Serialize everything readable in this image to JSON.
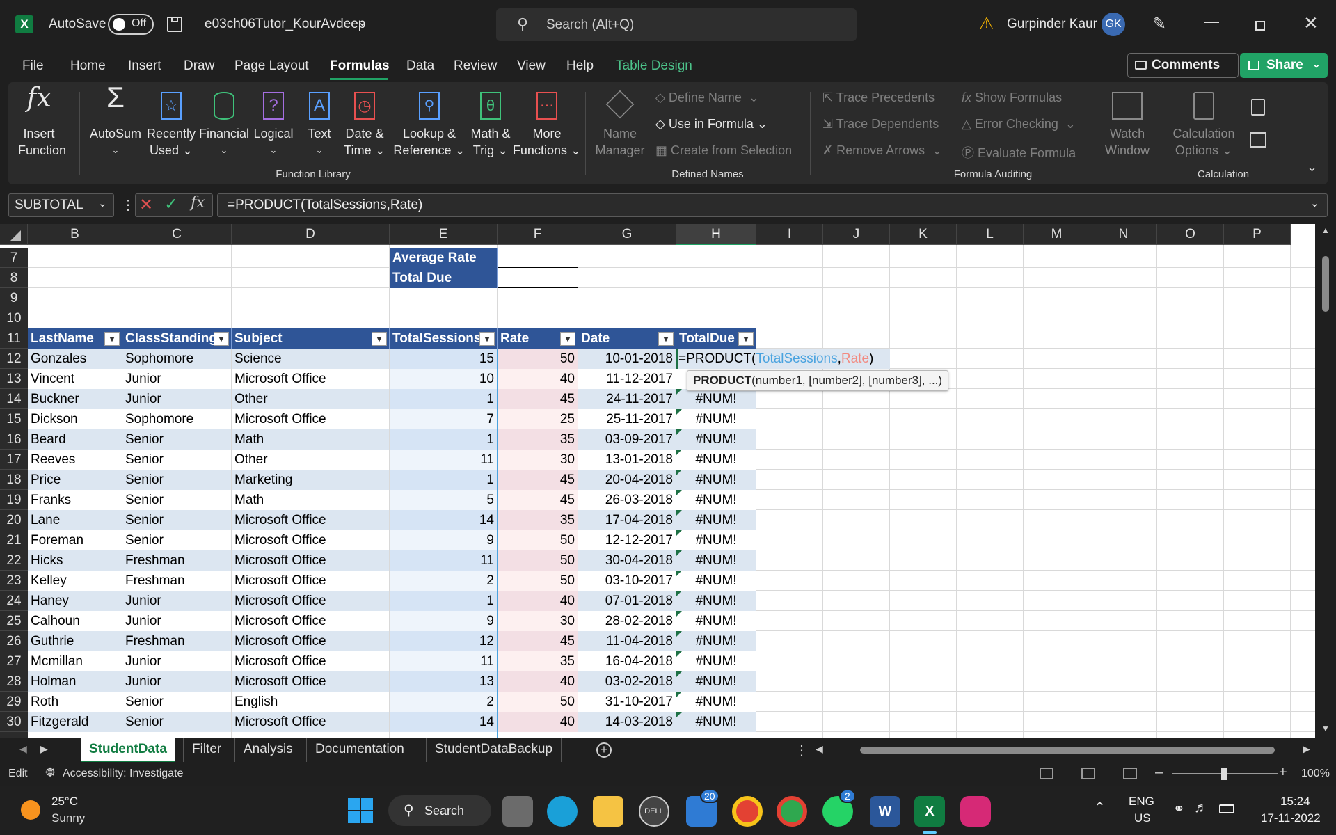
{
  "titlebar": {
    "app_icon": "excel-icon",
    "autosave_label": "AutoSave",
    "autosave_state": "Off",
    "filename": "e03ch06Tutor_KourAvdeep",
    "search_placeholder": "Search (Alt+Q)",
    "user_name": "Gurpinder Kaur",
    "user_initials": "GK"
  },
  "menu": {
    "items": [
      "File",
      "Home",
      "Insert",
      "Draw",
      "Page Layout",
      "Formulas",
      "Data",
      "Review",
      "View",
      "Help",
      "Table Design"
    ],
    "active": "Formulas",
    "comments": "Comments",
    "share": "Share"
  },
  "ribbon": {
    "insert_function": [
      "Insert",
      "Function"
    ],
    "autosum": "AutoSum",
    "recently_used": [
      "Recently",
      "Used"
    ],
    "financial": "Financial",
    "logical": "Logical",
    "text": "Text",
    "date_time": [
      "Date &",
      "Time"
    ],
    "lookup": [
      "Lookup &",
      "Reference"
    ],
    "math": [
      "Math &",
      "Trig"
    ],
    "more": [
      "More",
      "Functions"
    ],
    "group_function_library": "Function Library",
    "name_manager": [
      "Name",
      "Manager"
    ],
    "define_name": "Define Name",
    "use_in_formula": "Use in Formula",
    "create_from_selection": "Create from Selection",
    "group_defined_names": "Defined Names",
    "trace_precedents": "Trace Precedents",
    "trace_dependents": "Trace Dependents",
    "remove_arrows": "Remove Arrows",
    "show_formulas": "Show Formulas",
    "error_checking": "Error Checking",
    "evaluate_formula": "Evaluate Formula",
    "watch_window": [
      "Watch",
      "Window"
    ],
    "group_formula_auditing": "Formula Auditing",
    "calc_options": [
      "Calculation",
      "Options"
    ],
    "group_calculation": "Calculation"
  },
  "formula_bar": {
    "name_box": "SUBTOTAL",
    "fx": "fx",
    "formula": "=PRODUCT(TotalSessions,Rate)"
  },
  "sheet": {
    "columns": [
      "B",
      "C",
      "D",
      "E",
      "F",
      "G",
      "H",
      "I",
      "J",
      "K",
      "L",
      "M",
      "N",
      "O",
      "P"
    ],
    "selected_column": "H",
    "info_rows": [
      {
        "row": "7",
        "label": "Average Rate"
      },
      {
        "row": "8",
        "label": "Total Due"
      }
    ],
    "empty_rows": [
      "9",
      "10"
    ],
    "header_row": "11",
    "headers": [
      "LastName",
      "ClassStanding",
      "Subject",
      "TotalSessions",
      "Rate",
      "Date",
      "TotalDue"
    ],
    "active_cell_formula": {
      "prefix": "=PRODUCT(",
      "arg1": "TotalSessions",
      "comma": ",",
      "arg2": "Rate",
      "suffix": ")"
    },
    "tooltip": {
      "fn": "PRODUCT",
      "args": "(number1, [number2], [number3], ...)"
    },
    "rows": [
      {
        "row": "12",
        "last": "Gonzales",
        "standing": "Sophomore",
        "subject": "Science",
        "sessions": "15",
        "rate": "50",
        "date": "10-01-2018",
        "due": ""
      },
      {
        "row": "13",
        "last": "Vincent",
        "standing": "Junior",
        "subject": "Microsoft Office",
        "sessions": "10",
        "rate": "40",
        "date": "11-12-2017",
        "due": ""
      },
      {
        "row": "14",
        "last": "Buckner",
        "standing": "Junior",
        "subject": "Other",
        "sessions": "1",
        "rate": "45",
        "date": "24-11-2017",
        "due": "#NUM!"
      },
      {
        "row": "15",
        "last": "Dickson",
        "standing": "Sophomore",
        "subject": "Microsoft Office",
        "sessions": "7",
        "rate": "25",
        "date": "25-11-2017",
        "due": "#NUM!"
      },
      {
        "row": "16",
        "last": "Beard",
        "standing": "Senior",
        "subject": "Math",
        "sessions": "1",
        "rate": "35",
        "date": "03-09-2017",
        "due": "#NUM!"
      },
      {
        "row": "17",
        "last": "Reeves",
        "standing": "Senior",
        "subject": "Other",
        "sessions": "11",
        "rate": "30",
        "date": "13-01-2018",
        "due": "#NUM!"
      },
      {
        "row": "18",
        "last": "Price",
        "standing": "Senior",
        "subject": "Marketing",
        "sessions": "1",
        "rate": "45",
        "date": "20-04-2018",
        "due": "#NUM!"
      },
      {
        "row": "19",
        "last": "Franks",
        "standing": "Senior",
        "subject": "Math",
        "sessions": "5",
        "rate": "45",
        "date": "26-03-2018",
        "due": "#NUM!"
      },
      {
        "row": "20",
        "last": "Lane",
        "standing": "Senior",
        "subject": "Microsoft Office",
        "sessions": "14",
        "rate": "35",
        "date": "17-04-2018",
        "due": "#NUM!"
      },
      {
        "row": "21",
        "last": "Foreman",
        "standing": "Senior",
        "subject": "Microsoft Office",
        "sessions": "9",
        "rate": "50",
        "date": "12-12-2017",
        "due": "#NUM!"
      },
      {
        "row": "22",
        "last": "Hicks",
        "standing": "Freshman",
        "subject": "Microsoft Office",
        "sessions": "11",
        "rate": "50",
        "date": "30-04-2018",
        "due": "#NUM!"
      },
      {
        "row": "23",
        "last": "Kelley",
        "standing": "Freshman",
        "subject": "Microsoft Office",
        "sessions": "2",
        "rate": "50",
        "date": "03-10-2017",
        "due": "#NUM!"
      },
      {
        "row": "24",
        "last": "Haney",
        "standing": "Junior",
        "subject": "Microsoft Office",
        "sessions": "1",
        "rate": "40",
        "date": "07-01-2018",
        "due": "#NUM!"
      },
      {
        "row": "25",
        "last": "Calhoun",
        "standing": "Junior",
        "subject": "Microsoft Office",
        "sessions": "9",
        "rate": "30",
        "date": "28-02-2018",
        "due": "#NUM!"
      },
      {
        "row": "26",
        "last": "Guthrie",
        "standing": "Freshman",
        "subject": "Microsoft Office",
        "sessions": "12",
        "rate": "45",
        "date": "11-04-2018",
        "due": "#NUM!"
      },
      {
        "row": "27",
        "last": "Mcmillan",
        "standing": "Junior",
        "subject": "Microsoft Office",
        "sessions": "11",
        "rate": "35",
        "date": "16-04-2018",
        "due": "#NUM!"
      },
      {
        "row": "28",
        "last": "Holman",
        "standing": "Junior",
        "subject": "Microsoft Office",
        "sessions": "13",
        "rate": "40",
        "date": "03-02-2018",
        "due": "#NUM!"
      },
      {
        "row": "29",
        "last": "Roth",
        "standing": "Senior",
        "subject": "English",
        "sessions": "2",
        "rate": "50",
        "date": "31-10-2017",
        "due": "#NUM!"
      },
      {
        "row": "30",
        "last": "Fitzgerald",
        "standing": "Senior",
        "subject": "Microsoft Office",
        "sessions": "14",
        "rate": "40",
        "date": "14-03-2018",
        "due": "#NUM!"
      }
    ]
  },
  "sheet_tabs": [
    "StudentData",
    "Filter",
    "Analysis",
    "Documentation",
    "StudentDataBackup"
  ],
  "active_sheet": "StudentData",
  "status": {
    "mode": "Edit",
    "accessibility": "Accessibility: Investigate",
    "zoom": "100%"
  },
  "taskbar": {
    "temp": "25°C",
    "weather": "Sunny",
    "search": "Search",
    "mail_badge": "20",
    "whatsapp_badge": "2",
    "lang": "ENG",
    "region": "US",
    "time": "15:24",
    "date": "17-11-2022"
  },
  "colors": {
    "table_header": "#2f5597",
    "band_light": "#dce6f1",
    "excel_green": "#21a366",
    "error_triangle": "#1e7145"
  }
}
